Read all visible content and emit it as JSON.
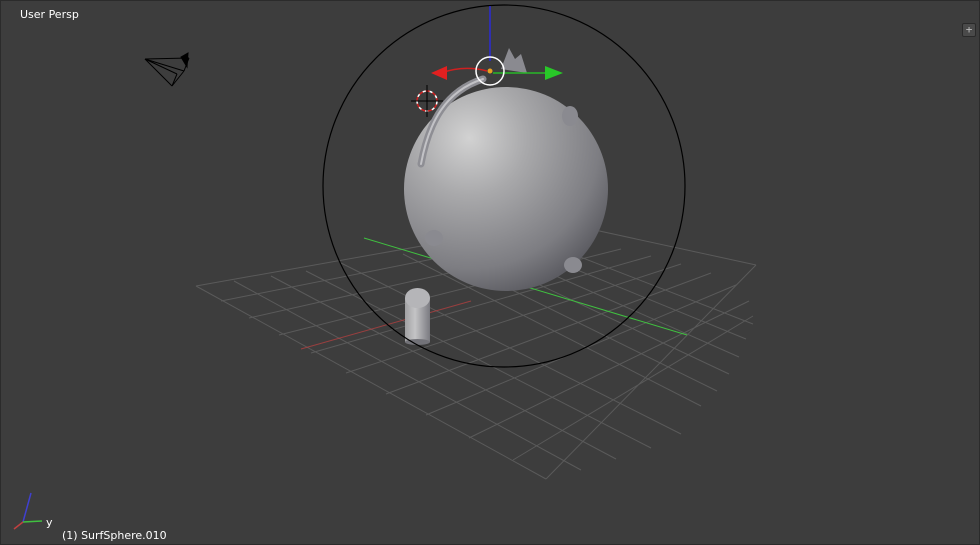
{
  "viewport": {
    "view_name": "User Persp",
    "active_object": "(1) SurfSphere.010",
    "corner_widget": "+"
  },
  "axis_indicator": {
    "y_label": "y"
  },
  "colors": {
    "background": "#3d3d3d",
    "grid": "#5a5a5a",
    "x_axis": "#c04040",
    "y_axis": "#40c040",
    "z_axis": "#4040d0",
    "selection_circle": "#000000"
  }
}
